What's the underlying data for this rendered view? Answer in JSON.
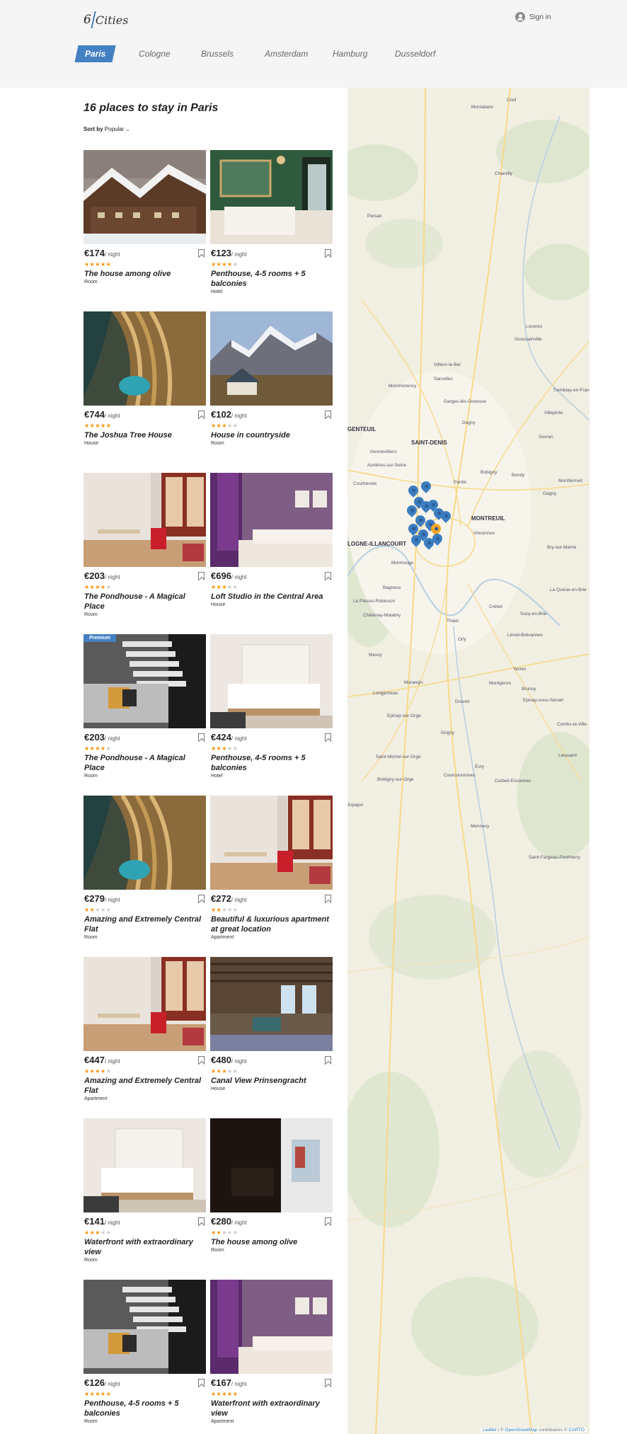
{
  "header": {
    "logo_number": "6",
    "logo_word": "Cities",
    "signin_label": "Sign in"
  },
  "tabs": [
    {
      "label": "Paris",
      "active": true
    },
    {
      "label": "Cologne"
    },
    {
      "label": "Brussels"
    },
    {
      "label": "Amsterdam"
    },
    {
      "label": "Hamburg"
    },
    {
      "label": "Dusseldorf"
    }
  ],
  "main": {
    "title": "16 places to stay in Paris",
    "sort_label": "Sort by",
    "sort_value": "Popular",
    "per_night": "/ night",
    "premium_label": "Premium"
  },
  "cards": [
    {
      "price": "€174",
      "rating": 5,
      "name": "The house among olive",
      "type": "Room",
      "image": "snowy-chalet-photo"
    },
    {
      "price": "€123",
      "rating": 4,
      "name": "Penthouse, 4-5 rooms + 5 balconies",
      "type": "Hotel",
      "image": "green-bedroom-photo"
    },
    {
      "price": "€744",
      "rating": 5,
      "name": "The Joshua Tree House",
      "type": "House",
      "image": "aerial-resort-photo"
    },
    {
      "price": "€102",
      "rating": 3,
      "name": "House in countryside",
      "type": "Room",
      "image": "mountain-house-photo"
    },
    {
      "price": "€203",
      "rating": 4,
      "name": "The Pondhouse - A Magical Place",
      "type": "Room",
      "image": "bright-living-room-photo"
    },
    {
      "price": "€696",
      "rating": 3,
      "name": "Loft Studio in the Central Area",
      "type": "House",
      "image": "purple-bedroom-photo"
    },
    {
      "price": "€203",
      "rating": 4,
      "name": "The Pondhouse - A Magical Place",
      "type": "Room",
      "image": "staircase-lounge-photo",
      "premium": true
    },
    {
      "price": "€424",
      "rating": 3,
      "name": "Penthouse, 4-5 rooms + 5 balconies",
      "type": "Hotel",
      "image": "white-bedroom-photo"
    },
    {
      "price": "€279",
      "rating": 2,
      "name": "Amazing and Extremely Central Flat",
      "type": "Room",
      "image": "aerial-resort-photo"
    },
    {
      "price": "€272",
      "rating": 2,
      "name": "Beautiful & luxurious apartment at great location",
      "type": "Apartment",
      "image": "bright-living-room-photo"
    },
    {
      "price": "€447",
      "rating": 4,
      "name": "Amazing and Extremely Central Flat",
      "type": "Apartment",
      "image": "bright-living-room-photo"
    },
    {
      "price": "€480",
      "rating": 3,
      "name": "Canal View Prinsengracht",
      "type": "House",
      "image": "rustic-interior-photo"
    },
    {
      "price": "€141",
      "rating": 3,
      "name": "Waterfront with extraordinary view",
      "type": "Room",
      "image": "white-bedroom-photo"
    },
    {
      "price": "€280",
      "rating": 2,
      "name": "The house among olive",
      "type": "Room",
      "image": "dark-room-window-photo"
    },
    {
      "price": "€126",
      "rating": 5,
      "name": "Penthouse, 4-5 rooms + 5 balconies",
      "type": "Room",
      "image": "staircase-lounge-photo"
    },
    {
      "price": "€167",
      "rating": 5,
      "name": "Waterfront with extraordinary view",
      "type": "Apartment",
      "image": "purple-bedroom-photo"
    }
  ],
  "map": {
    "labels": [
      "Montataire",
      "Creil",
      "Chantilly",
      "Persan",
      "Louvres",
      "Goussainville",
      "Villiers-le-Bel",
      "Sarcelles",
      "Montmorency",
      "Garges-lès-Gonesse",
      "Tremblay-en-France",
      "Villepinte",
      "Dugny",
      "Sevran",
      "SAINT-DENIS",
      "Gennevilliers",
      "Asnières-sur-Seine",
      "Bobigny",
      "Bondy",
      "Pantin",
      "Courbevoie",
      "Montfermeil",
      "Gagny",
      "MONTREUIL",
      "Vincennes",
      "Bry-sur-Marne",
      "Montrouge",
      "Bagneux",
      "La Queue-en-Brie",
      "Le Plessis-Robinson",
      "Créteil",
      "Sucy-en-Brie",
      "Châtenay-Malabry",
      "Thiais",
      "Limeil-Brévannes",
      "Orly",
      "Massy",
      "Yerres",
      "Morangis",
      "Montgeron",
      "Brunoy",
      "Longjumeau",
      "Draveil",
      "Epinay-sous-Sénart",
      "Epinay-sur-Orge",
      "Combs-la-Ville",
      "Grigny",
      "Lieusaint",
      "Saint-Michel-sur-Orge",
      "Évry",
      "Courcouronnes",
      "Corbeil-Essonnes",
      "Brétigny-sur-Orge",
      "Arpajon",
      "Mennecy",
      "Saint-Fargeau-Ponthierry",
      "GENTEUIL",
      "LOGNE-ILLANCOURT"
    ],
    "attribution_leaflet": "Leaflet",
    "attribution_sep": "| ©",
    "attribution_osm": "OpenStreetMap",
    "attribution_mid": "contributors ©",
    "attribution_carto": "CARTO"
  }
}
